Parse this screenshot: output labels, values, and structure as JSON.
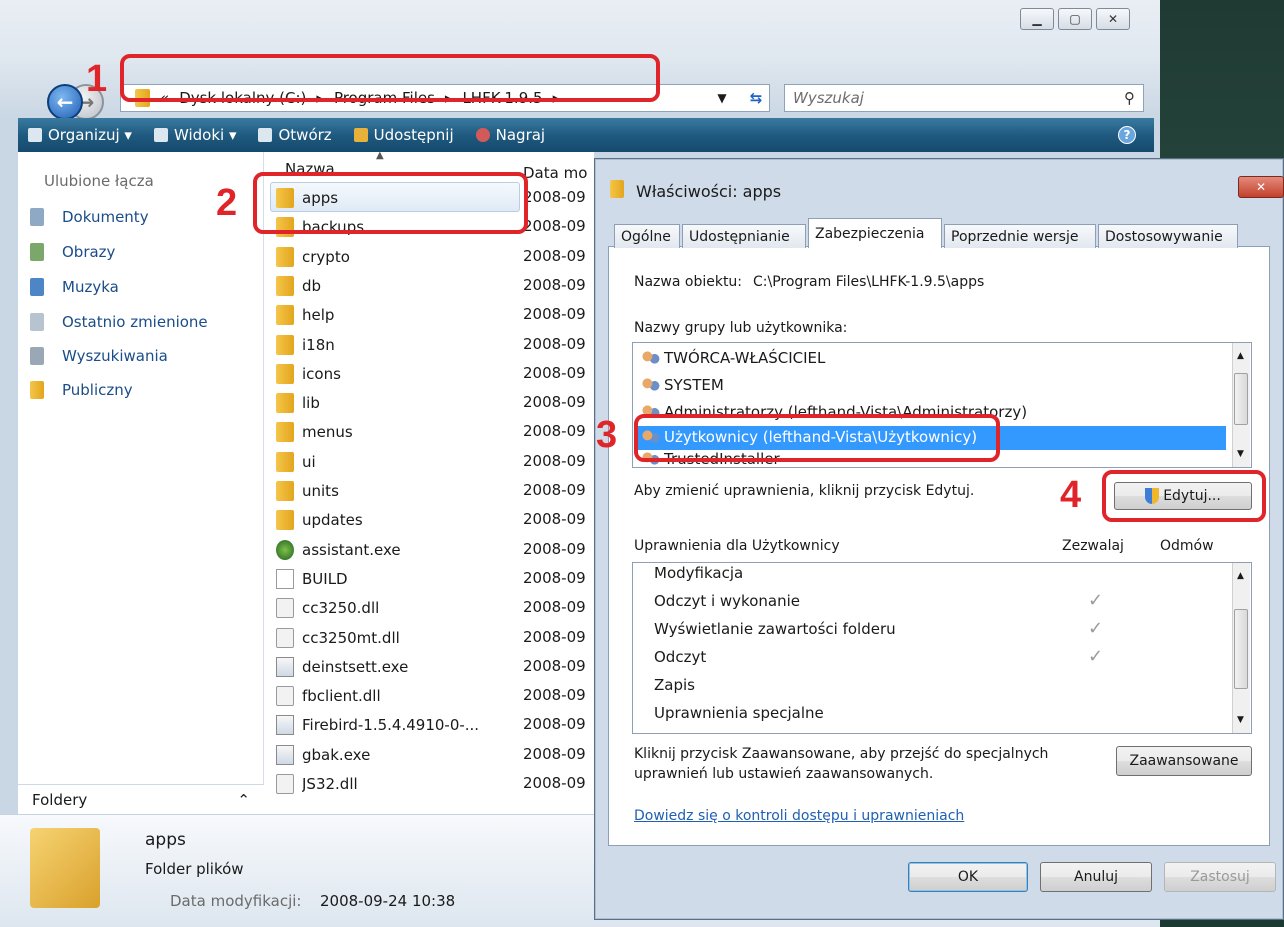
{
  "explorer": {
    "address_parts": [
      "«",
      "Dysk lokalny (C:)",
      "▸",
      "Program Files",
      "▸",
      "LHFK-1.9.5",
      "▸"
    ],
    "search_placeholder": "Wyszukaj",
    "toolbar": [
      "Organizuj ▾",
      "Widoki ▾",
      "Otwórz",
      "Udostępnij",
      "Nagraj"
    ],
    "fav_title": "Ulubione łącza",
    "favorites": [
      "Dokumenty",
      "Obrazy",
      "Muzyka",
      "Ostatnio zmienione",
      "Wyszukiwania",
      "Publiczny"
    ],
    "folders_label": "Foldery",
    "col_name": "Nazwa",
    "col_date": "Data mo",
    "files": [
      {
        "name": "apps",
        "type": "folder",
        "date": "2008-09"
      },
      {
        "name": "backups",
        "type": "folder",
        "date": "2008-09"
      },
      {
        "name": "crypto",
        "type": "folder",
        "date": "2008-09"
      },
      {
        "name": "db",
        "type": "folder",
        "date": "2008-09"
      },
      {
        "name": "help",
        "type": "folder",
        "date": "2008-09"
      },
      {
        "name": "i18n",
        "type": "folder",
        "date": "2008-09"
      },
      {
        "name": "icons",
        "type": "folder",
        "date": "2008-09"
      },
      {
        "name": "lib",
        "type": "folder",
        "date": "2008-09"
      },
      {
        "name": "menus",
        "type": "folder",
        "date": "2008-09"
      },
      {
        "name": "ui",
        "type": "folder",
        "date": "2008-09"
      },
      {
        "name": "units",
        "type": "folder",
        "date": "2008-09"
      },
      {
        "name": "updates",
        "type": "folder",
        "date": "2008-09"
      },
      {
        "name": "assistant.exe",
        "type": "green",
        "date": "2008-09"
      },
      {
        "name": "BUILD",
        "type": "file",
        "date": "2008-09"
      },
      {
        "name": "cc3250.dll",
        "type": "dll",
        "date": "2008-09"
      },
      {
        "name": "cc3250mt.dll",
        "type": "dll",
        "date": "2008-09"
      },
      {
        "name": "deinstsett.exe",
        "type": "exe",
        "date": "2008-09"
      },
      {
        "name": "fbclient.dll",
        "type": "dll",
        "date": "2008-09"
      },
      {
        "name": "Firebird-1.5.4.4910-0-...",
        "type": "exe",
        "date": "2008-09"
      },
      {
        "name": "gbak.exe",
        "type": "exe",
        "date": "2008-09"
      },
      {
        "name": "JS32.dll",
        "type": "dll",
        "date": "2008-09"
      }
    ],
    "details": {
      "name": "apps",
      "type": "Folder plików",
      "mod_label": "Data modyfikacji:",
      "mod_value": "2008-09-24 10:38"
    }
  },
  "dialog": {
    "title": "Właściwości: apps",
    "close_label": "✕",
    "tabs": [
      "Ogólne",
      "Udostępnianie",
      "Zabezpieczenia",
      "Poprzednie wersje",
      "Dostosowywanie"
    ],
    "object_label": "Nazwa obiektu:",
    "object_value": "C:\\Program Files\\LHFK-1.9.5\\apps",
    "groups_label": "Nazwy grupy lub użytkownika:",
    "users": [
      "TWÓRCA-WŁAŚCICIEL",
      "SYSTEM",
      "Administratorzy (lefthand-Vista\\Administratorzy)",
      "Użytkownicy (lefthand-Vista\\Użytkownicy)",
      "TrustedInstaller"
    ],
    "change_hint": "Aby zmienić uprawnienia, kliknij przycisk Edytuj.",
    "edit_button": "Edytuj...",
    "perm_header": "Uprawnienia dla Użytkownicy",
    "allow_header": "Zezwalaj",
    "deny_header": "Odmów",
    "permissions": [
      {
        "name": "Modyfikacja",
        "allow": false
      },
      {
        "name": "Odczyt i wykonanie",
        "allow": true
      },
      {
        "name": "Wyświetlanie zawartości folderu",
        "allow": true
      },
      {
        "name": "Odczyt",
        "allow": true
      },
      {
        "name": "Zapis",
        "allow": false
      },
      {
        "name": "Uprawnienia specjalne",
        "allow": false
      }
    ],
    "advanced_hint_1": "Kliknij przycisk Zaawansowane, aby przejść do specjalnych",
    "advanced_hint_2": "uprawnień lub ustawień zaawansowanych.",
    "advanced_button": "Zaawansowane",
    "help_link": "Dowiedz się o kontroli dostępu i uprawnieniach",
    "ok": "OK",
    "cancel": "Anuluj",
    "apply": "Zastosuj"
  },
  "annotations": [
    "1",
    "2",
    "3",
    "4"
  ],
  "colors": {
    "highlight": "#e0252a",
    "selection": "#3399ff",
    "toolbar": "#205a80"
  }
}
